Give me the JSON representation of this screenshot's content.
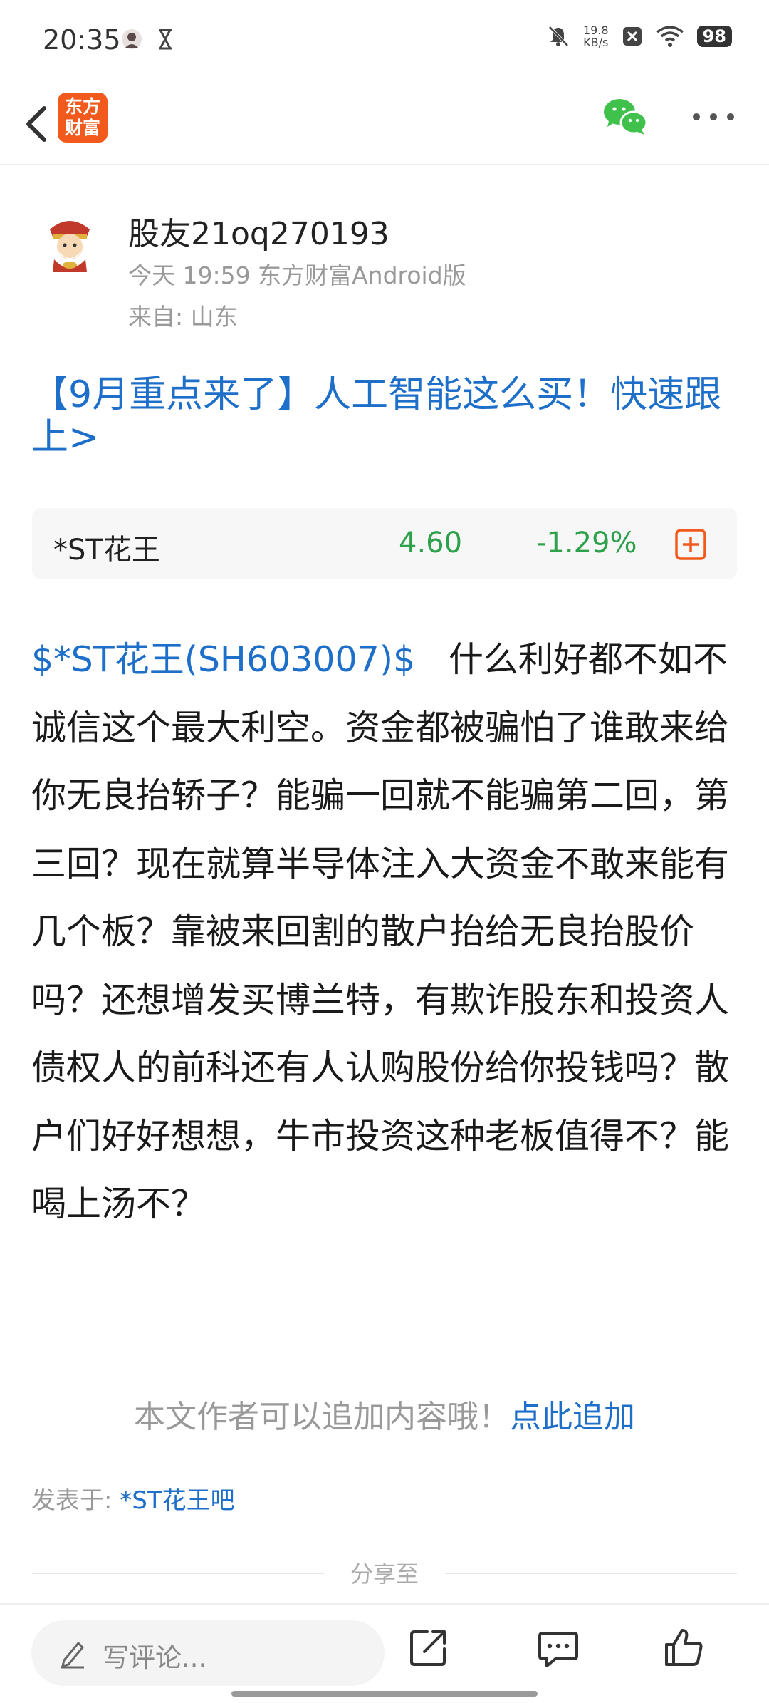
{
  "status": {
    "time": "20:35",
    "netspeed_value": "19.8",
    "netspeed_unit": "KB/s",
    "battery": "98"
  },
  "header": {
    "logo_line1": "东方",
    "logo_line2": "财富"
  },
  "author": {
    "name": "股友21oq270193",
    "meta": "今天 19:59 东方财富Android版",
    "from": "来自: 山东"
  },
  "promo": "【9月重点来了】人工智能这么买！快速跟上>",
  "quote": {
    "name": "*ST花王",
    "price": "4.60",
    "change": "-1.29%"
  },
  "post": {
    "tag": "$*ST花王(SH603007)$",
    "body": "什么利好都不如不诚信这个最大利空。资金都被骗怕了谁敢来给你无良抬轿子？能骗一回就不能骗第二回，第三回？现在就算半导体注入大资金不敢来能有几个板？靠被来回割的散户抬给无良抬股价吗？还想增发买博兰特，有欺诈股东和投资人债权人的前科还有人认购股份给你投钱吗？散户们好好想想，牛市投资这种老板值得不？能喝上汤不？"
  },
  "append": {
    "text": "本文作者可以追加内容哦！",
    "link": "点此追加"
  },
  "posted": {
    "label": "发表于: ",
    "bar": "*ST花王吧"
  },
  "share_label": "分享至",
  "bottom": {
    "comment_placeholder": "写评论..."
  },
  "colors": {
    "brand_orange": "#f25a1d",
    "link_blue": "#1d6fca",
    "down_green": "#2ea14c",
    "wechat_green": "#3fc14c"
  }
}
